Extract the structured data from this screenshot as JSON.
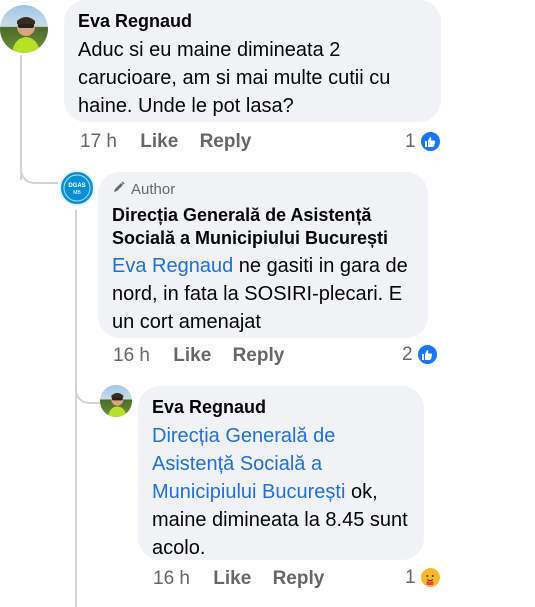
{
  "comments": [
    {
      "author": "Eva Regnaud",
      "text": "Aduc si eu maine dimineata 2 carucioare, am si mai multe cutii cu haine. Unde le pot lasa?",
      "time": "17 h",
      "like_label": "Like",
      "reply_label": "Reply",
      "reaction_count": "1",
      "reaction_icon": "like-icon"
    },
    {
      "author_badge": "Author",
      "author": "Direcția Generală de Asistență Socială a Municipiului București",
      "mention": "Eva Regnaud",
      "text": " ne gasiti in gara de nord, in fata la SOSIRI-plecari. E un cort amenajat",
      "time": "16 h",
      "like_label": "Like",
      "reply_label": "Reply",
      "reaction_count": "2",
      "reaction_icon": "like-icon",
      "avatar_text": "DGASMB"
    },
    {
      "author": "Eva Regnaud",
      "mention": "Direcția Generală de Asistență Socială a Municipiului București",
      "text": " ok, maine dimineata la 8.45 sunt acolo.",
      "time": "16 h",
      "like_label": "Like",
      "reply_label": "Reply",
      "reaction_count": "1",
      "reaction_icon": "care-icon"
    }
  ],
  "colors": {
    "bubble": "#f0f2f5",
    "link": "#216fdb",
    "meta": "#65676b",
    "like_blue": "#1877f2",
    "care_yellow": "#f7b928"
  }
}
